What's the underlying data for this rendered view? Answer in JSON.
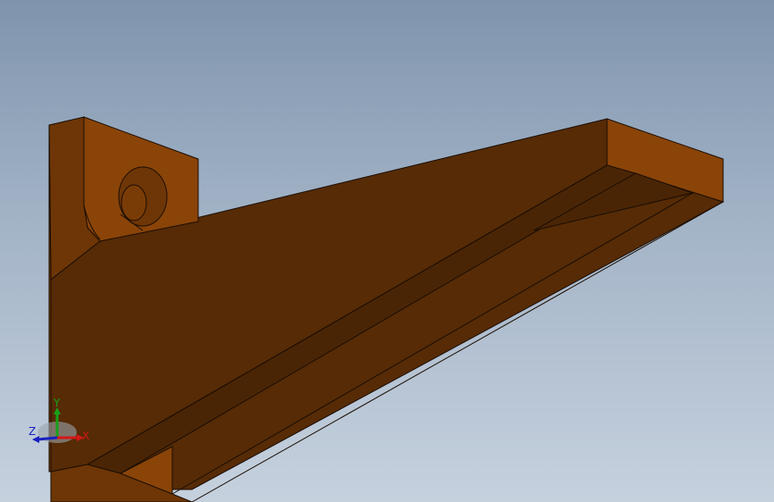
{
  "viewport": {
    "background_top": "#7f94ad",
    "background_bottom": "#c6d1de"
  },
  "model": {
    "name": "angle bracket",
    "colors": {
      "face_light": "#8a4408",
      "face_mid": "#6e3606",
      "face_dark": "#562b06",
      "face_darker": "#4a2505",
      "edge": "#1a0d02"
    }
  },
  "triad": {
    "x_label": "X",
    "y_label": "Y",
    "z_label": "Z",
    "x_color": "#d01818",
    "y_color": "#18a018",
    "z_color": "#1820c0"
  }
}
